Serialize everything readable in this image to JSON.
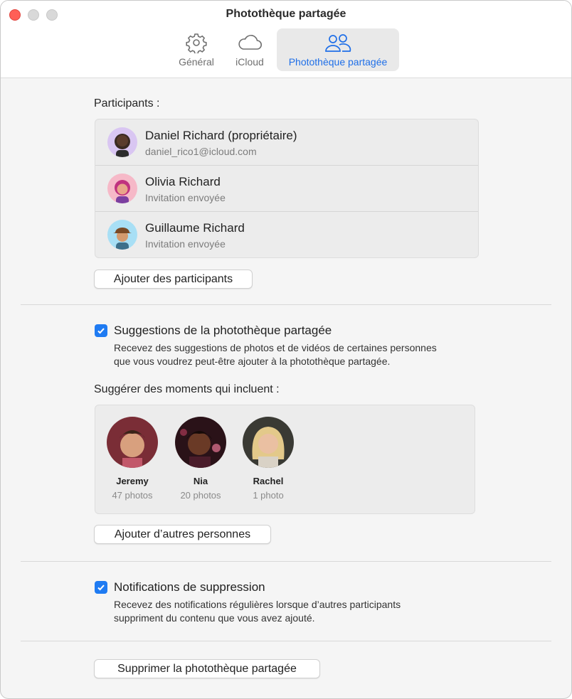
{
  "window": {
    "title": "Photothèque partagée"
  },
  "tabs": [
    {
      "label": "Général",
      "icon": "gear-icon"
    },
    {
      "label": "iCloud",
      "icon": "cloud-icon"
    },
    {
      "label": "Photothèque partagée",
      "icon": "people-icon",
      "selected": true
    }
  ],
  "participants": {
    "label": "Participants :",
    "items": [
      {
        "name": "Daniel Richard (propriétaire)",
        "detail": "daniel_rico1@icloud.com"
      },
      {
        "name": "Olivia Richard",
        "detail": "Invitation envoyée"
      },
      {
        "name": "Guillaume Richard",
        "detail": "Invitation envoyée"
      }
    ],
    "add_button": "Ajouter des participants"
  },
  "suggestions": {
    "checked": true,
    "title": "Suggestions de la photothèque partagée",
    "desc_line1": "Recevez des suggestions de photos et de vidéos de certaines personnes",
    "desc_line2": "que vous voudrez peut-être ajouter à la photothèque partagée.",
    "moments_label": "Suggérer des moments qui incluent :",
    "people": [
      {
        "name": "Jeremy",
        "count": "47 photos"
      },
      {
        "name": "Nia",
        "count": "20 photos"
      },
      {
        "name": "Rachel",
        "count": "1 photo"
      }
    ],
    "add_button": "Ajouter d’autres personnes"
  },
  "deletion": {
    "checked": true,
    "title": "Notifications de suppression",
    "desc_line1": "Recevez des notifications régulières lorsque d’autres participants",
    "desc_line2": "suppriment du contenu que vous avez ajouté."
  },
  "delete_button": "Supprimer la photothèque partagée",
  "colors": {
    "accent": "#1f7bf2",
    "close": "#ff5f57"
  }
}
